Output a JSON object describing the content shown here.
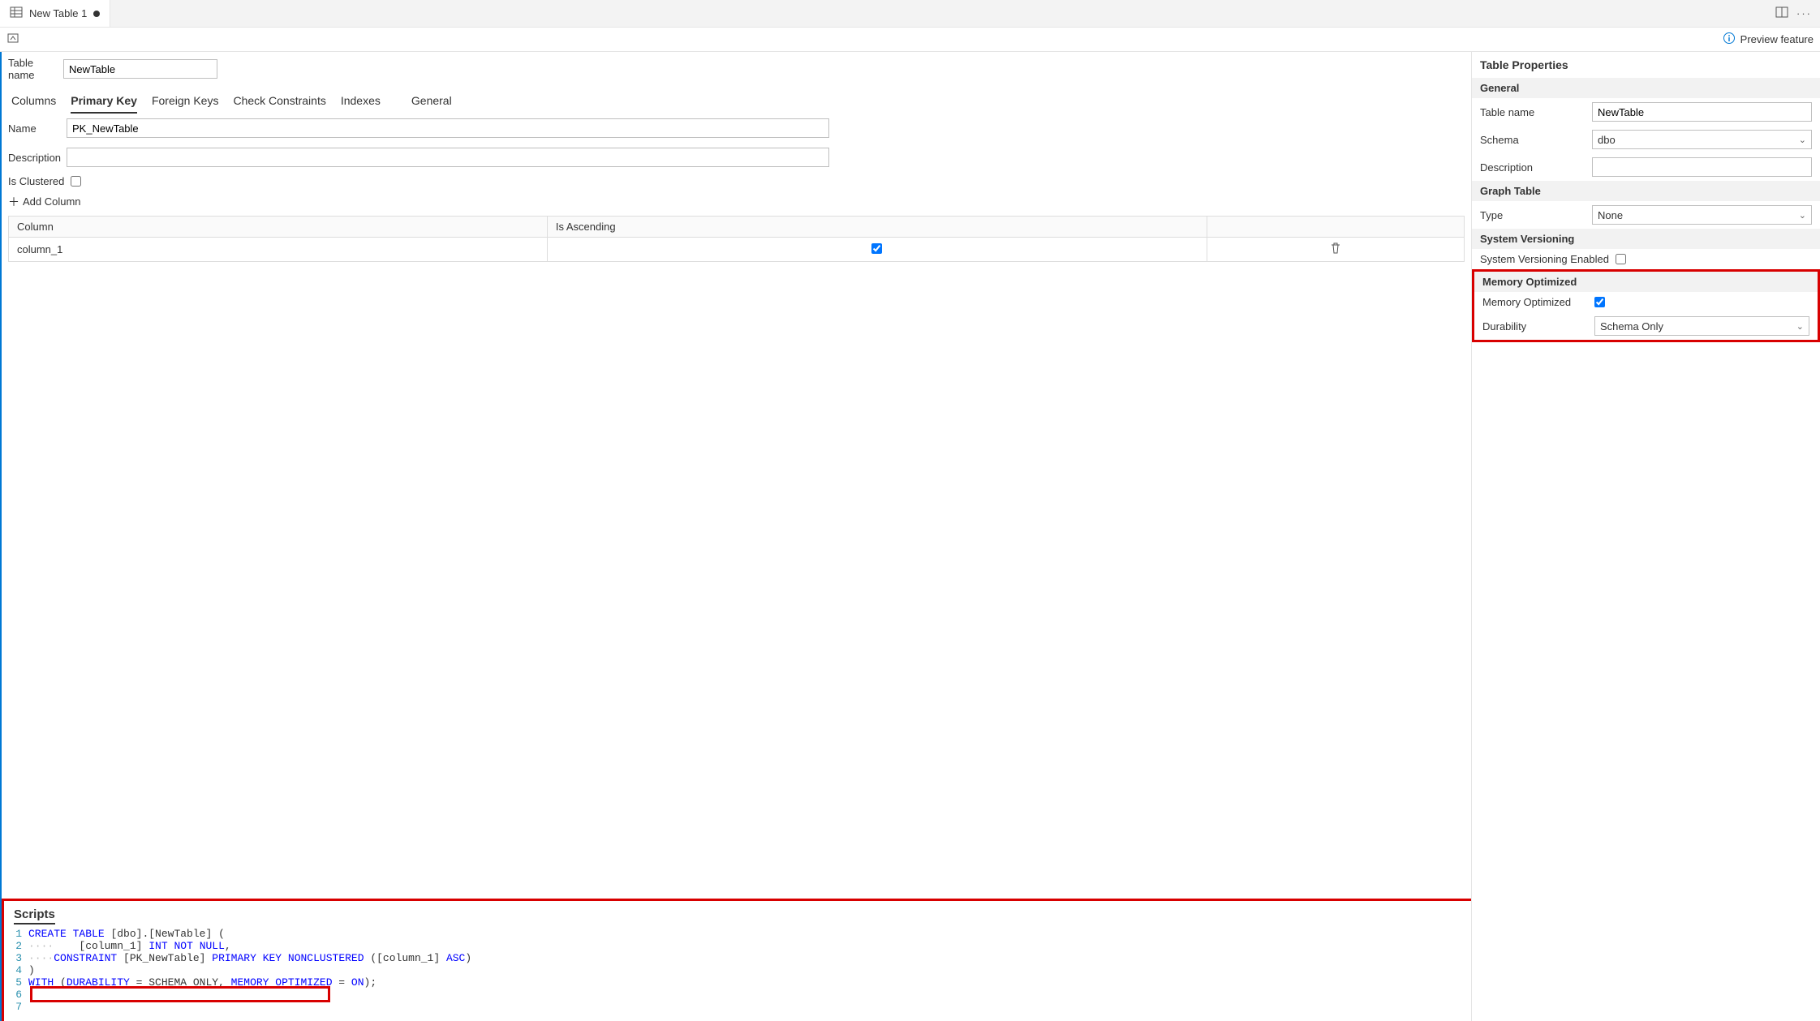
{
  "tab": {
    "title": "New Table 1"
  },
  "toolbar": {
    "preview_label": "Preview feature"
  },
  "tableNameLabel": "Table name",
  "tableNameValue": "NewTable",
  "designerTabs": {
    "columns": "Columns",
    "primaryKey": "Primary Key",
    "foreignKeys": "Foreign Keys",
    "checkConstraints": "Check Constraints",
    "indexes": "Indexes",
    "general": "General"
  },
  "pk": {
    "nameLabel": "Name",
    "nameValue": "PK_NewTable",
    "descLabel": "Description",
    "descValue": "",
    "isClusteredLabel": "Is Clustered",
    "addColumnLabel": "Add Column",
    "grid": {
      "colHeader": "Column",
      "ascHeader": "Is Ascending",
      "rows": [
        {
          "column": "column_1",
          "ascending": true
        }
      ]
    }
  },
  "scripts": {
    "title": "Scripts",
    "lines": {
      "l1a": "CREATE",
      "l1b": " ",
      "l1c": "TABLE",
      "l1d": " [dbo].[NewTable] (",
      "l2a": "    [column_1] ",
      "l2b": "INT",
      "l2c": " ",
      "l2d": "NOT",
      "l2e": " ",
      "l2f": "NULL",
      "l2g": ",",
      "l3a": "    ",
      "l3b": "CONSTRAINT",
      "l3c": " [PK_NewTable] ",
      "l3d": "PRIMARY",
      "l3e": " ",
      "l3f": "KEY",
      "l3g": " ",
      "l3h": "NONCLUSTERED",
      "l3i": " ([column_1] ",
      "l3j": "ASC",
      "l3k": ")",
      "l4": ")",
      "l5a": "WITH",
      "l5b": " (",
      "l5c": "DURABILITY",
      "l5d": " = SCHEMA_ONLY, ",
      "l5e": "MEMORY_OPTIMIZED",
      "l5f": " = ",
      "l5g": "ON",
      "l5h": ");"
    }
  },
  "rightPanel": {
    "title": "Table Properties",
    "general": {
      "header": "General",
      "tableNameLabel": "Table name",
      "tableNameValue": "NewTable",
      "schemaLabel": "Schema",
      "schemaValue": "dbo",
      "descLabel": "Description",
      "descValue": ""
    },
    "graph": {
      "header": "Graph Table",
      "typeLabel": "Type",
      "typeValue": "None"
    },
    "sysver": {
      "header": "System Versioning",
      "enabledLabel": "System Versioning Enabled"
    },
    "mem": {
      "header": "Memory Optimized",
      "optLabel": "Memory Optimized",
      "durLabel": "Durability",
      "durValue": "Schema Only"
    }
  }
}
